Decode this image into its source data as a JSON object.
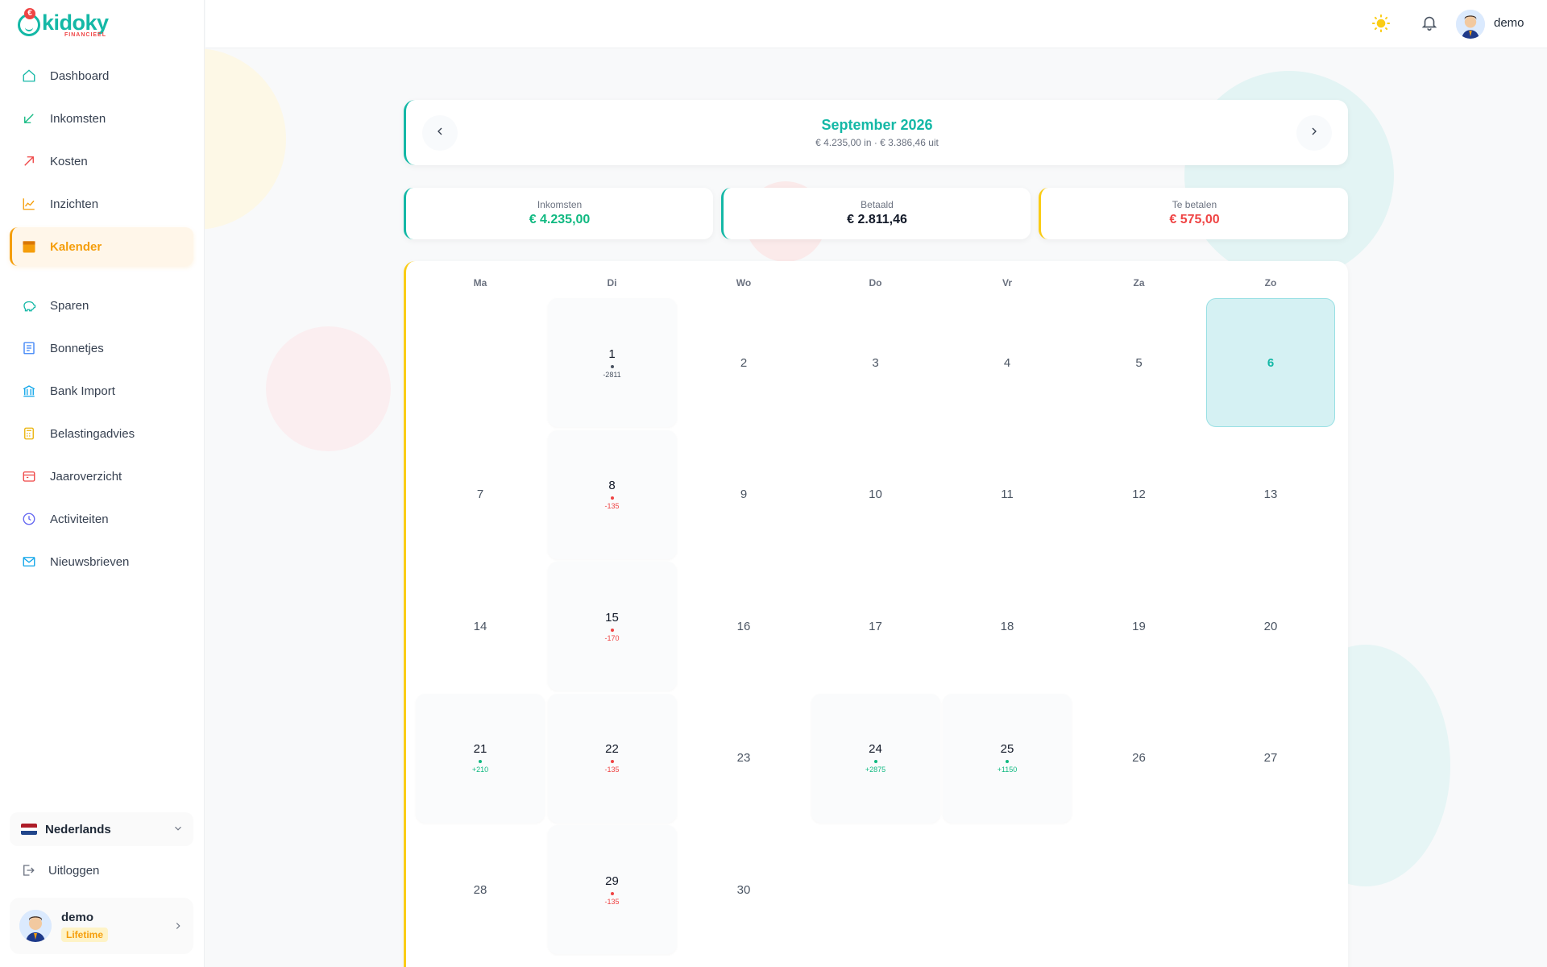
{
  "brand": {
    "name": "kidoky",
    "sub": "FINANCIEEL",
    "currency_badge": "€"
  },
  "nav": [
    {
      "label": "Dashboard",
      "icon": "home-icon"
    },
    {
      "label": "Inkomsten",
      "icon": "arrow-down-left-icon"
    },
    {
      "label": "Kosten",
      "icon": "arrow-up-right-icon"
    },
    {
      "label": "Inzichten",
      "icon": "line-chart-icon"
    },
    {
      "label": "Kalender",
      "icon": "calendar-icon",
      "active": true
    },
    {
      "label": "Sparen",
      "icon": "piggy-bank-icon"
    },
    {
      "label": "Bonnetjes",
      "icon": "receipt-icon"
    },
    {
      "label": "Bank Import",
      "icon": "bank-icon"
    },
    {
      "label": "Belastingadvies",
      "icon": "calculator-icon"
    },
    {
      "label": "Jaaroverzicht",
      "icon": "calendar-card-icon"
    },
    {
      "label": "Activiteiten",
      "icon": "clock-icon"
    },
    {
      "label": "Nieuwsbrieven",
      "icon": "mail-icon"
    }
  ],
  "language": {
    "label": "Nederlands"
  },
  "logout": {
    "label": "Uitloggen"
  },
  "user": {
    "name": "demo",
    "plan": "Lifetime"
  },
  "topbar": {
    "username": "demo"
  },
  "month": {
    "title": "September 2026",
    "summary": "€ 4.235,00 in · € 3.386,46 uit"
  },
  "summary_cards": [
    {
      "label": "Inkomsten",
      "value": "€ 4.235,00",
      "color": "#10b981",
      "accent": "#14b8a6"
    },
    {
      "label": "Betaald",
      "value": "€ 2.811,46",
      "color": "#111827",
      "accent": "#14b8a6"
    },
    {
      "label": "Te betalen",
      "value": "€ 575,00",
      "color": "#ef4444",
      "accent": "#facc15"
    }
  ],
  "calendar": {
    "weekdays": [
      "Ma",
      "Di",
      "Wo",
      "Do",
      "Vr",
      "Za",
      "Zo"
    ],
    "start_weekday": 1,
    "days_in_month": 30,
    "today": 6,
    "events": [
      {
        "day": 1,
        "amount": "-2811",
        "color": "#4b5563"
      },
      {
        "day": 8,
        "amount": "-135",
        "color": "#ef4444"
      },
      {
        "day": 15,
        "amount": "-170",
        "color": "#ef4444"
      },
      {
        "day": 21,
        "amount": "+210",
        "color": "#10b981"
      },
      {
        "day": 22,
        "amount": "-135",
        "color": "#ef4444"
      },
      {
        "day": 24,
        "amount": "+2875",
        "color": "#10b981"
      },
      {
        "day": 25,
        "amount": "+1150",
        "color": "#10b981"
      },
      {
        "day": 29,
        "amount": "-135",
        "color": "#ef4444"
      }
    ]
  }
}
